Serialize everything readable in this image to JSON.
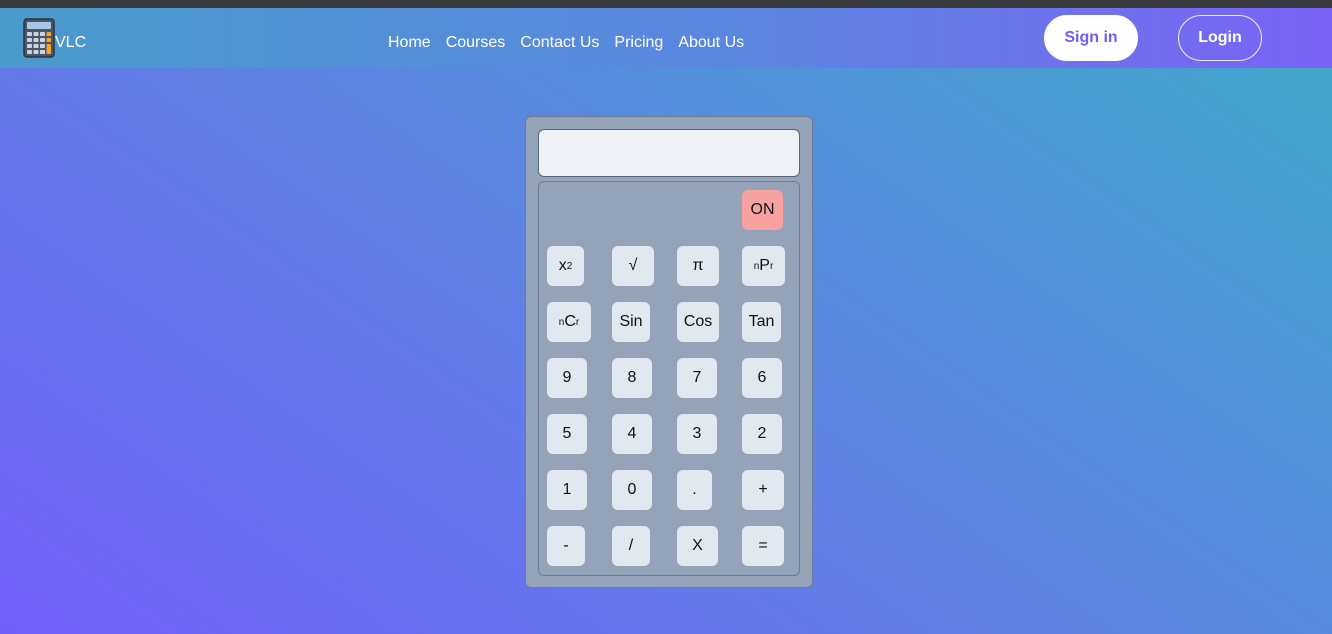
{
  "nav": {
    "brand": "VLC",
    "links": [
      "Home",
      "Courses",
      "Contact Us",
      "Pricing",
      "About Us"
    ],
    "signin_label": "Sign in",
    "login_label": "Login"
  },
  "calculator": {
    "display_value": "",
    "on_label": "ON",
    "keys": {
      "square_base": "x",
      "square_sup": "2",
      "sqrt": "√",
      "pi": "π",
      "npr_sup": "n",
      "npr_main": "P",
      "npr_sub": "r",
      "ncr_sup": "n",
      "ncr_main": "C",
      "ncr_sub": "r",
      "sin": "Sin",
      "cos": "Cos",
      "tan": "Tan",
      "k9": "9",
      "k8": "8",
      "k7": "7",
      "k6": "6",
      "k5": "5",
      "k4": "4",
      "k3": "3",
      "k2": "2",
      "k1": "1",
      "k0": "0",
      "dot": ".",
      "plus": "+",
      "minus": "-",
      "divide": "/",
      "multiply": "X",
      "equals": "="
    }
  },
  "colors": {
    "on_key": "#f7a1a1",
    "key": "#e2e8f0",
    "calc_body": "#94a3b8",
    "signin_text": "#6c5ff0"
  },
  "icons": {
    "logo": "calculator-icon"
  }
}
